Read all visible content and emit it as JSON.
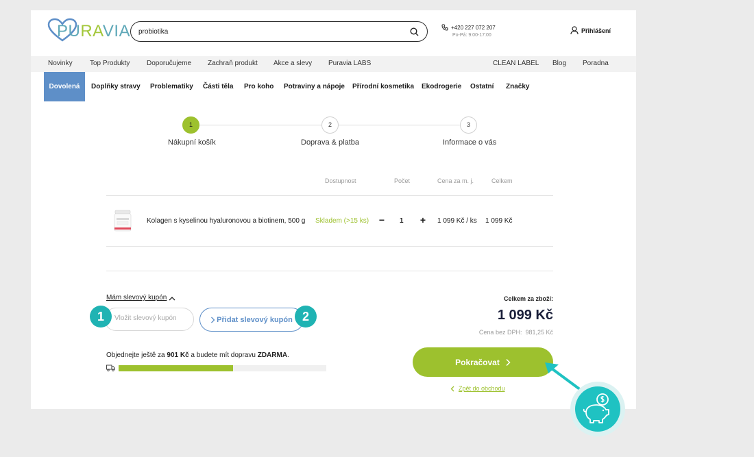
{
  "header": {
    "logo": {
      "part1": "PU",
      "part2": "RA",
      "part3": "VIA"
    },
    "search": {
      "value": "probiotika",
      "placeholder": ""
    },
    "phone": {
      "number": "+420 227 072 207",
      "hours": "Po-Pá: 9:00-17:00"
    },
    "login_label": "Přihlášení"
  },
  "top_nav": {
    "left": [
      "Novinky",
      "Top Produkty",
      "Doporučujeme",
      "Zachraň produkt",
      "Akce a slevy",
      "Puravia LABS"
    ],
    "right": [
      "CLEAN LABEL",
      "Blog",
      "Poradna"
    ]
  },
  "category_nav": {
    "active": "Dovolená",
    "items": [
      "Doplňky stravy",
      "Problematiky",
      "Části těla",
      "Pro koho",
      "Potraviny a nápoje",
      "Přírodní kosmetika",
      "Ekodrogerie",
      "Ostatní",
      "Značky"
    ]
  },
  "steps": [
    {
      "number": "1",
      "label": "Nákupní košík",
      "state": "active"
    },
    {
      "number": "2",
      "label": "Doprava & platba",
      "state": "todo"
    },
    {
      "number": "3",
      "label": "Informace o vás",
      "state": "todo"
    }
  ],
  "cart": {
    "headers": {
      "availability": "Dostupnost",
      "quantity": "Počet",
      "unit_price": "Cena za m. j.",
      "total": "Celkem"
    },
    "items": [
      {
        "name": "Kolagen s kyselinou hyaluronovou a biotinem, 500 g",
        "availability": "Skladem (>15 ks)",
        "minus": "−",
        "quantity": "1",
        "plus": "+",
        "unit_price": "1 099 Kč / ks",
        "total": "1 099 Kč"
      }
    ]
  },
  "coupon": {
    "toggle_label": "Mám slevový kupón",
    "input_placeholder": "Vložit slevový kupón",
    "add_button": "Přidat slevový kupón"
  },
  "callouts": {
    "one": "1",
    "two": "2"
  },
  "shipping": {
    "text_before": "Objednejte ještě za ",
    "amount": "901 Kč",
    "text_middle": " a budete mít dopravu ",
    "free": "ZDARMA",
    "text_after": ".",
    "progress_percent": 55
  },
  "summary": {
    "total_label": "Celkem za zboží:",
    "total_price": "1 099 Kč",
    "vat_label": "Cena bez DPH:",
    "vat_value": "981,25 Kč"
  },
  "actions": {
    "continue_label": "Pokračovat",
    "back_label": "Zpět do obchodu"
  },
  "colors": {
    "accent_green": "#9dc12e",
    "accent_blue": "#5e8fc8",
    "callout_teal": "#1fb3b3",
    "page_bg": "#ebebeb"
  }
}
